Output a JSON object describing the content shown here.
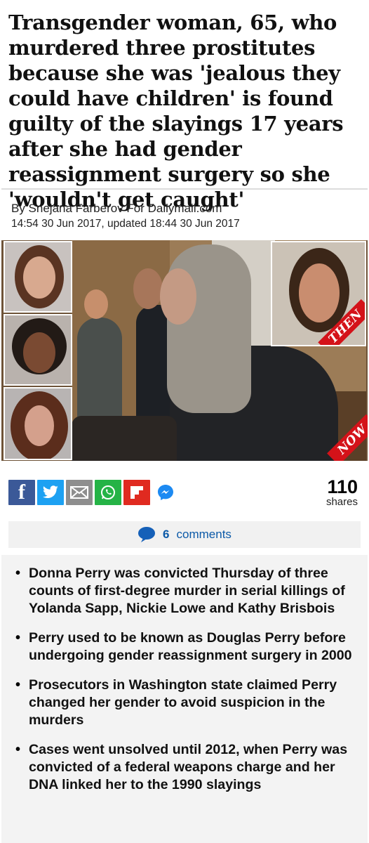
{
  "article": {
    "headline": "Transgender woman, 65, who murdered three prostitutes because she was 'jealous they could have children' is found guilty of the slayings 17 years after she had gender reassignment surgery so she 'wouldn't get caught'",
    "byline": "By Snejana Farberov For Dailymail.com",
    "date": "14:54 30 Jun 2017, updated 18:44 30 Jun 2017"
  },
  "photo": {
    "tag_then": "THEN",
    "tag_now": "NOW"
  },
  "share": {
    "icons": [
      "facebook-icon",
      "twitter-icon",
      "email-icon",
      "whatsapp-icon",
      "flipboard-icon",
      "messenger-icon"
    ],
    "facebook_glyph": "f",
    "count": "110",
    "count_label": "shares"
  },
  "comments": {
    "count": "6",
    "label": "comments",
    "accent": "#0c5aa8"
  },
  "bullets": [
    "Donna Perry was convicted Thursday of three counts of first-degree murder in serial killings of Yolanda Sapp, Nickie Lowe and Kathy Brisbois",
    "Perry used to be known as Douglas Perry before undergoing gender reassignment surgery in 2000",
    "Prosecutors in Washington state claimed Perry changed her gender to avoid suspicion in the murders",
    "Cases went unsolved until 2012, when Perry was convicted of a federal weapons charge and her DNA linked her to the 1990 slayings"
  ],
  "colors": {
    "facebook": "#3b5998",
    "twitter": "#1da1f2",
    "email": "#8e8e8e",
    "whatsapp": "#25b346",
    "flipboard": "#e02a20",
    "tag_red": "#d41219"
  }
}
